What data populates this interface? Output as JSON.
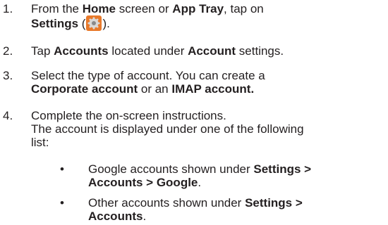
{
  "steps": [
    {
      "number": "1.",
      "parts": {
        "t1": "From the ",
        "b1": "Home",
        "t2": " screen or ",
        "b2": "App Tray",
        "t3": ", tap on",
        "b3": "Settings",
        "t4": " (",
        "t5": ")."
      },
      "icon": "settings-gear-icon"
    },
    {
      "number": "2.",
      "parts": {
        "t1": "Tap ",
        "b1": "Accounts",
        "t2": " located under ",
        "b2": "Account",
        "t3": " settings."
      }
    },
    {
      "number": "3.",
      "parts": {
        "line1": "Select the type of account. You can create a",
        "b1": "Corporate account",
        "t1": " or an ",
        "b2": "IMAP account."
      }
    },
    {
      "number": "4.",
      "parts": {
        "line1": "Complete the on-screen instructions.",
        "line2": "The account is displayed under one of the following",
        "line3": "list:"
      }
    }
  ],
  "bullets": [
    {
      "dot": "•",
      "t1": "Google accounts shown under ",
      "b1": "Settings >",
      "b2": "Accounts > Google",
      "t2": "."
    },
    {
      "dot": "•",
      "t1": "Other accounts shown under ",
      "b1": "Settings >",
      "b2": "Accounts",
      "t2": "."
    }
  ],
  "colors": {
    "text": "#231f20",
    "icon_bg": "#e8792a",
    "icon_gear": "#d9d9d9"
  }
}
